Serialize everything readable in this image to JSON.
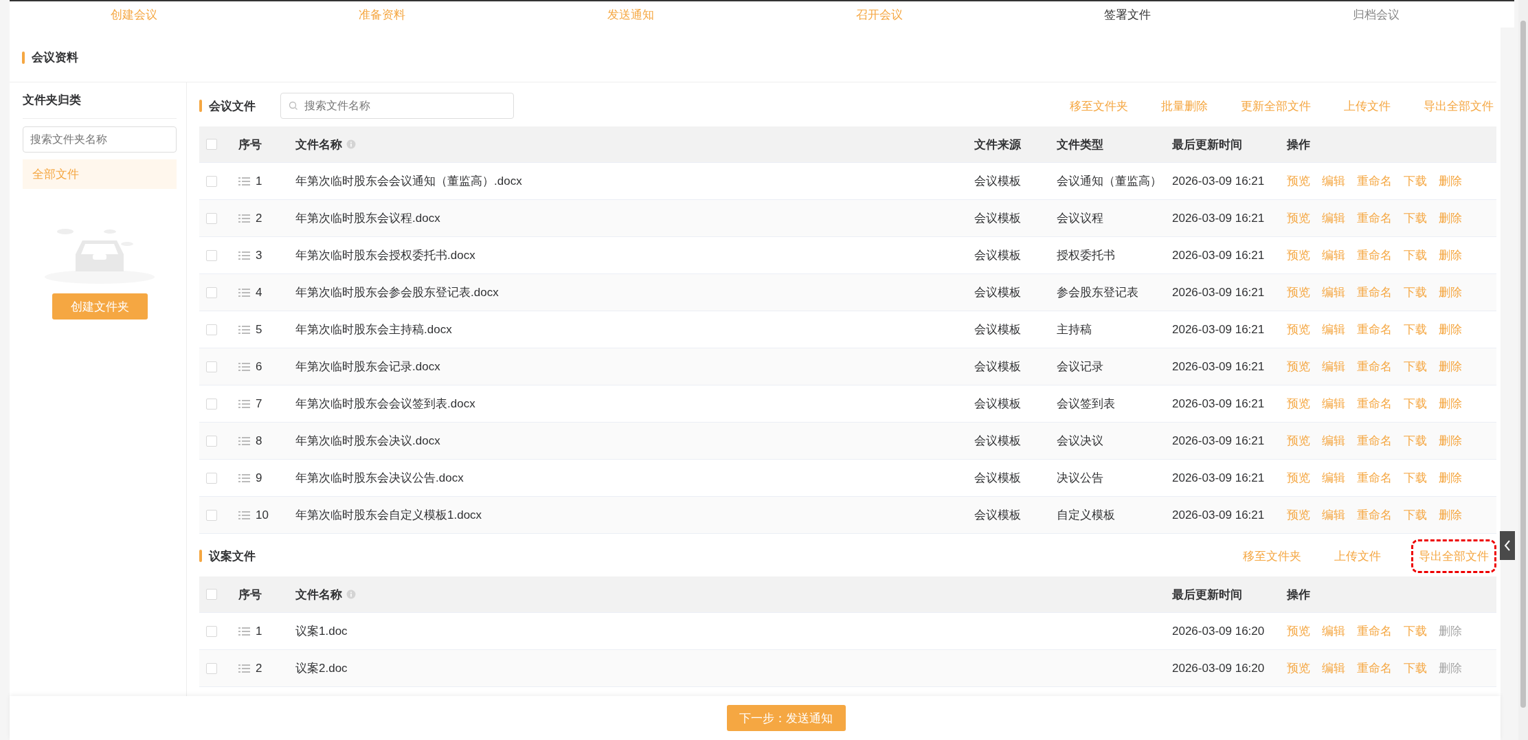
{
  "steps": [
    {
      "label": "创建会议",
      "completed": true,
      "selected": false
    },
    {
      "label": "准备资料",
      "completed": true,
      "selected": false
    },
    {
      "label": "发送通知",
      "completed": true,
      "selected": false
    },
    {
      "label": "召开会议",
      "completed": true,
      "selected": false
    },
    {
      "label": "签署文件",
      "completed": false,
      "selected": true
    },
    {
      "label": "归档会议",
      "completed": false,
      "selected": false
    }
  ],
  "page_title": "会议资料",
  "sidebar": {
    "title": "文件夹归类",
    "search": {
      "placeholder": "搜索文件夹名称"
    },
    "items": [
      {
        "label": "全部文件",
        "selected": true
      }
    ],
    "create_button": "创建文件夹"
  },
  "sections": [
    {
      "kind": "meeting",
      "title": "会议文件",
      "all_checked": false,
      "search": {
        "placeholder": "搜索文件名称"
      },
      "actions": [
        {
          "label": "移至文件夹",
          "highlighted": false
        },
        {
          "label": "批量删除",
          "highlighted": false
        },
        {
          "label": "更新全部文件",
          "highlighted": false
        },
        {
          "label": "上传文件",
          "highlighted": false
        },
        {
          "label": "导出全部文件",
          "highlighted": false
        }
      ],
      "columns": [
        {
          "label": "序号",
          "info": false
        },
        {
          "label": "文件名称",
          "info": true
        },
        {
          "label": "文件来源",
          "info": false
        },
        {
          "label": "文件类型",
          "info": false
        },
        {
          "label": "最后更新时间",
          "info": false
        },
        {
          "label": "操作",
          "info": false
        }
      ],
      "rows": [
        {
          "cells": [
            "1",
            "年第次临时股东会会议通知（董监高）.docx",
            "会议模板",
            "会议通知（董监高）",
            "2026-03-09 16:21"
          ],
          "checked": false,
          "actions": [
            {
              "label": "预览",
              "disabled": false
            },
            {
              "label": "编辑",
              "disabled": false
            },
            {
              "label": "重命名",
              "disabled": false
            },
            {
              "label": "下载",
              "disabled": false
            },
            {
              "label": "删除",
              "disabled": false
            }
          ]
        },
        {
          "cells": [
            "2",
            "年第次临时股东会议程.docx",
            "会议模板",
            "会议议程",
            "2026-03-09 16:21"
          ],
          "checked": false,
          "actions": [
            {
              "label": "预览",
              "disabled": false
            },
            {
              "label": "编辑",
              "disabled": false
            },
            {
              "label": "重命名",
              "disabled": false
            },
            {
              "label": "下载",
              "disabled": false
            },
            {
              "label": "删除",
              "disabled": false
            }
          ]
        },
        {
          "cells": [
            "3",
            "年第次临时股东会授权委托书.docx",
            "会议模板",
            "授权委托书",
            "2026-03-09 16:21"
          ],
          "checked": false,
          "actions": [
            {
              "label": "预览",
              "disabled": false
            },
            {
              "label": "编辑",
              "disabled": false
            },
            {
              "label": "重命名",
              "disabled": false
            },
            {
              "label": "下载",
              "disabled": false
            },
            {
              "label": "删除",
              "disabled": false
            }
          ]
        },
        {
          "cells": [
            "4",
            "年第次临时股东会参会股东登记表.docx",
            "会议模板",
            "参会股东登记表",
            "2026-03-09 16:21"
          ],
          "checked": false,
          "actions": [
            {
              "label": "预览",
              "disabled": false
            },
            {
              "label": "编辑",
              "disabled": false
            },
            {
              "label": "重命名",
              "disabled": false
            },
            {
              "label": "下载",
              "disabled": false
            },
            {
              "label": "删除",
              "disabled": false
            }
          ]
        },
        {
          "cells": [
            "5",
            "年第次临时股东会主持稿.docx",
            "会议模板",
            "主持稿",
            "2026-03-09 16:21"
          ],
          "checked": false,
          "actions": [
            {
              "label": "预览",
              "disabled": false
            },
            {
              "label": "编辑",
              "disabled": false
            },
            {
              "label": "重命名",
              "disabled": false
            },
            {
              "label": "下载",
              "disabled": false
            },
            {
              "label": "删除",
              "disabled": false
            }
          ]
        },
        {
          "cells": [
            "6",
            "年第次临时股东会记录.docx",
            "会议模板",
            "会议记录",
            "2026-03-09 16:21"
          ],
          "checked": false,
          "actions": [
            {
              "label": "预览",
              "disabled": false
            },
            {
              "label": "编辑",
              "disabled": false
            },
            {
              "label": "重命名",
              "disabled": false
            },
            {
              "label": "下载",
              "disabled": false
            },
            {
              "label": "删除",
              "disabled": false
            }
          ]
        },
        {
          "cells": [
            "7",
            "年第次临时股东会会议签到表.docx",
            "会议模板",
            "会议签到表",
            "2026-03-09 16:21"
          ],
          "checked": false,
          "actions": [
            {
              "label": "预览",
              "disabled": false
            },
            {
              "label": "编辑",
              "disabled": false
            },
            {
              "label": "重命名",
              "disabled": false
            },
            {
              "label": "下载",
              "disabled": false
            },
            {
              "label": "删除",
              "disabled": false
            }
          ]
        },
        {
          "cells": [
            "8",
            "年第次临时股东会决议.docx",
            "会议模板",
            "会议决议",
            "2026-03-09 16:21"
          ],
          "checked": false,
          "actions": [
            {
              "label": "预览",
              "disabled": false
            },
            {
              "label": "编辑",
              "disabled": false
            },
            {
              "label": "重命名",
              "disabled": false
            },
            {
              "label": "下载",
              "disabled": false
            },
            {
              "label": "删除",
              "disabled": false
            }
          ]
        },
        {
          "cells": [
            "9",
            "年第次临时股东会决议公告.docx",
            "会议模板",
            "决议公告",
            "2026-03-09 16:21"
          ],
          "checked": false,
          "actions": [
            {
              "label": "预览",
              "disabled": false
            },
            {
              "label": "编辑",
              "disabled": false
            },
            {
              "label": "重命名",
              "disabled": false
            },
            {
              "label": "下载",
              "disabled": false
            },
            {
              "label": "删除",
              "disabled": false
            }
          ]
        },
        {
          "cells": [
            "10",
            "年第次临时股东会自定义模板1.docx",
            "会议模板",
            "自定义模板",
            "2026-03-09 16:21"
          ],
          "checked": false,
          "actions": [
            {
              "label": "预览",
              "disabled": false
            },
            {
              "label": "编辑",
              "disabled": false
            },
            {
              "label": "重命名",
              "disabled": false
            },
            {
              "label": "下载",
              "disabled": false
            },
            {
              "label": "删除",
              "disabled": false
            }
          ]
        }
      ]
    },
    {
      "kind": "proposal",
      "title": "议案文件",
      "all_checked": false,
      "actions": [
        {
          "label": "移至文件夹",
          "highlighted": false
        },
        {
          "label": "上传文件",
          "highlighted": false
        },
        {
          "label": "导出全部文件",
          "highlighted": true
        }
      ],
      "columns": [
        {
          "label": "序号",
          "info": false
        },
        {
          "label": "文件名称",
          "info": true
        },
        {
          "label": "最后更新时间",
          "info": false
        },
        {
          "label": "操作",
          "info": false
        }
      ],
      "rows": [
        {
          "cells": [
            "1",
            "议案1.doc",
            "2026-03-09 16:20"
          ],
          "checked": false,
          "actions": [
            {
              "label": "预览",
              "disabled": false
            },
            {
              "label": "编辑",
              "disabled": false
            },
            {
              "label": "重命名",
              "disabled": false
            },
            {
              "label": "下载",
              "disabled": false
            },
            {
              "label": "删除",
              "disabled": true
            }
          ]
        },
        {
          "cells": [
            "2",
            "议案2.doc",
            "2026-03-09 16:20"
          ],
          "checked": false,
          "actions": [
            {
              "label": "预览",
              "disabled": false
            },
            {
              "label": "编辑",
              "disabled": false
            },
            {
              "label": "重命名",
              "disabled": false
            },
            {
              "label": "下载",
              "disabled": false
            },
            {
              "label": "删除",
              "disabled": true
            }
          ]
        }
      ]
    }
  ],
  "next_button": "下一步：发送通知"
}
